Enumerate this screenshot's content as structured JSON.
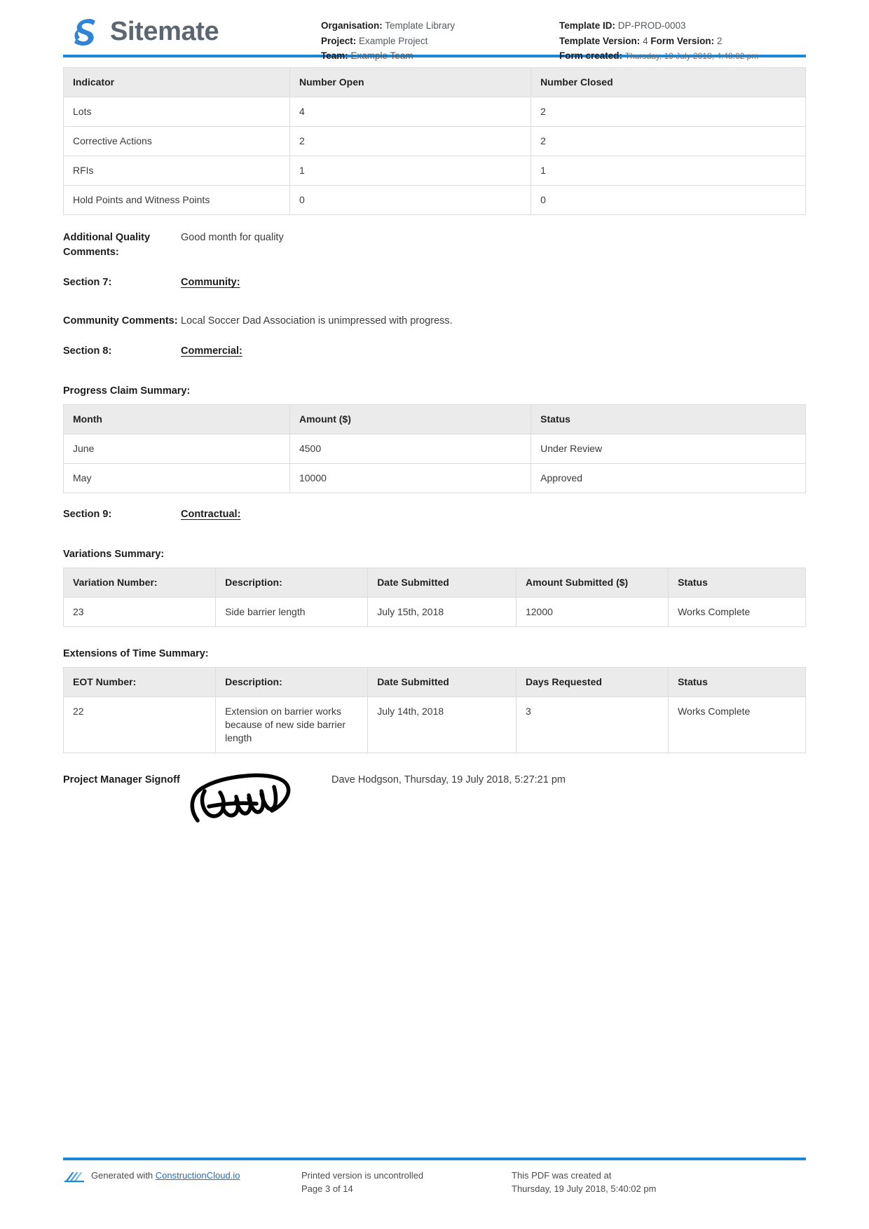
{
  "brand": {
    "name": "Sitemate",
    "logo_icon": "sitemate-logo-icon",
    "accent_color": "#1b87d8",
    "wordmark_color": "#5b6672"
  },
  "header": {
    "left": [
      {
        "label": "Organisation:",
        "value": "Template Library"
      },
      {
        "label": "Project:",
        "value": "Example Project"
      },
      {
        "label": "Team:",
        "value": "Example Team"
      }
    ],
    "right": {
      "template_id_label": "Template ID:",
      "template_id_value": "DP-PROD-0003",
      "template_version_label": "Template Version:",
      "template_version_value": "4",
      "form_version_label": "Form Version:",
      "form_version_value": "2",
      "form_created_label": "Form created:",
      "form_created_value": "Thursday, 19 July 2018, 4:48:02 pm"
    }
  },
  "indicator_table": {
    "columns": [
      "Indicator",
      "Number Open",
      "Number Closed"
    ],
    "rows": [
      [
        "Lots",
        "4",
        "2"
      ],
      [
        "Corrective Actions",
        "2",
        "2"
      ],
      [
        "RFIs",
        "1",
        "1"
      ],
      [
        "Hold Points and Witness Points",
        "0",
        "0"
      ]
    ]
  },
  "additional_quality": {
    "label": "Additional Quality Comments:",
    "value": "Good month for quality"
  },
  "section7": {
    "label": "Section 7:",
    "value": "Community:"
  },
  "community_comments": {
    "label": "Community Comments:",
    "value": "Local Soccer Dad Association is unimpressed with progress."
  },
  "section8": {
    "label": "Section 8:",
    "value": "Commercial:"
  },
  "progress_claim": {
    "title": "Progress Claim Summary:",
    "columns": [
      "Month",
      "Amount ($)",
      "Status"
    ],
    "rows": [
      [
        "June",
        "4500",
        "Under Review"
      ],
      [
        "May",
        "10000",
        "Approved"
      ]
    ]
  },
  "section9": {
    "label": "Section 9:",
    "value": "Contractual:"
  },
  "variations": {
    "title": "Variations Summary:",
    "columns": [
      "Variation Number:",
      "Description:",
      "Date Submitted",
      "Amount Submitted ($)",
      "Status"
    ],
    "rows": [
      [
        "23",
        "Side barrier length",
        "July 15th, 2018",
        "12000",
        "Works Complete"
      ]
    ]
  },
  "eot": {
    "title": "Extensions of Time Summary:",
    "columns": [
      "EOT Number:",
      "Description:",
      "Date Submitted",
      "Days Requested",
      "Status"
    ],
    "rows": [
      [
        "22",
        "Extension on barrier works because of new side barrier length",
        "July 14th, 2018",
        "3",
        "Works Complete"
      ]
    ]
  },
  "signoff": {
    "label": "Project Manager Signoff",
    "signature_icon": "handwritten-signature-image",
    "signed_by": "Dave Hodgson, Thursday, 19 July 2018, 5:27:21 pm"
  },
  "footer": {
    "generated_prefix": "Generated with ",
    "generated_link": "ConstructionCloud.io",
    "uncontrolled": "Printed version is uncontrolled",
    "page": "Page 3 of 14",
    "created_at_label": "This PDF was created at",
    "created_at_value": "Thursday, 19 July 2018, 5:40:02 pm",
    "logo_icon": "constructioncloud-logo-icon"
  }
}
